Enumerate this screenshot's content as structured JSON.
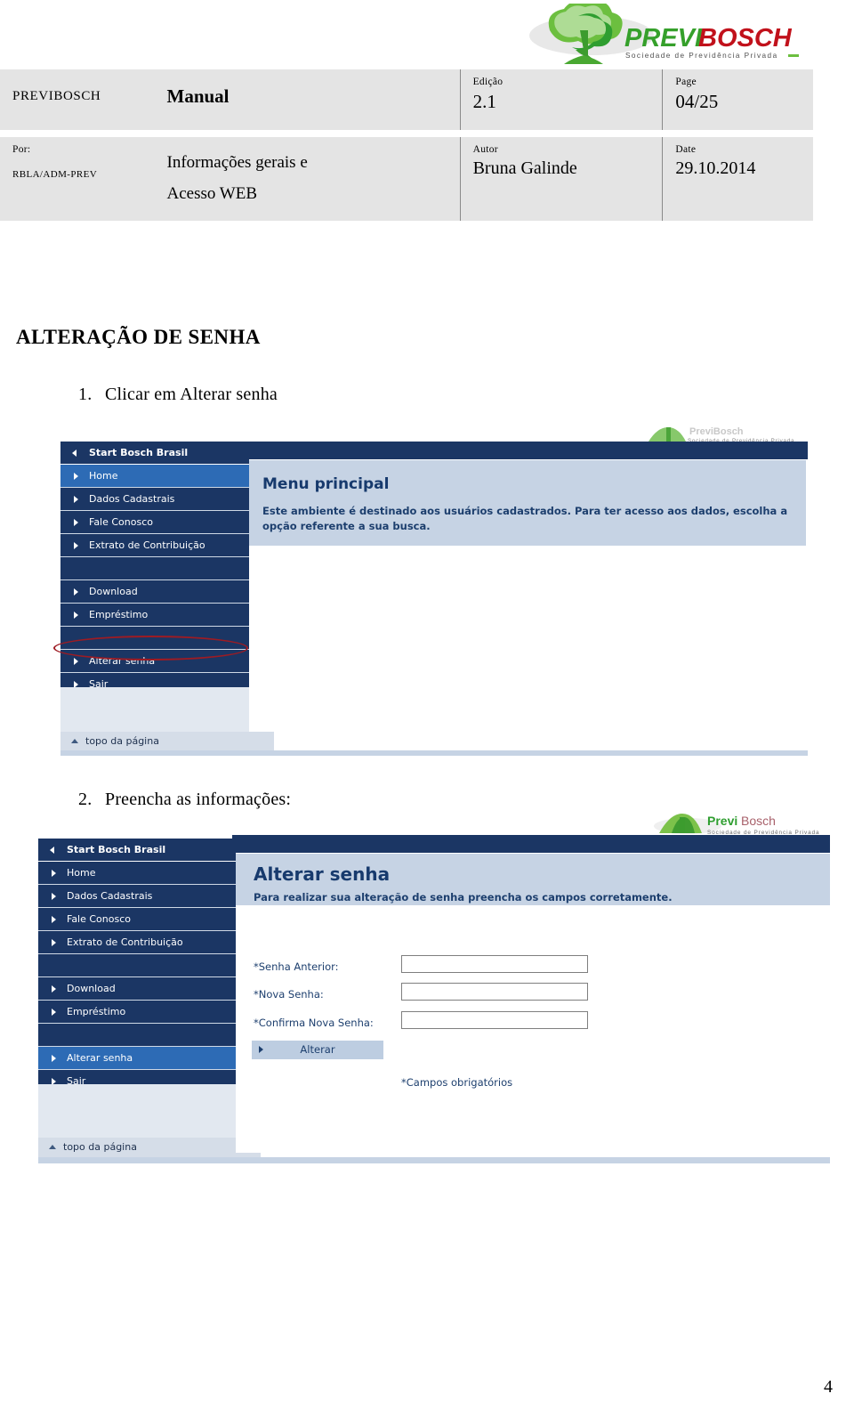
{
  "logo": {
    "name": "previbosch-logo",
    "text_part1": "PREVI",
    "text_part2": "BOSCH",
    "tagline": "Sociedade de Previdência Privada",
    "green": "#4aa829",
    "red": "#c1111b"
  },
  "header_table": {
    "row1": {
      "company": "PREVIBOSCH",
      "doc_type": "Manual",
      "edicao_label": "Edição",
      "edicao_value": "2.1",
      "page_label": "Page",
      "page_value": "04/25"
    },
    "row2": {
      "por_label": "Por:",
      "por_value": "RBLA/ADM-PREV",
      "subject_line1": "Informações gerais e",
      "subject_line2": "Acesso WEB",
      "autor_label": "Autor",
      "autor_value": "Bruna Galinde",
      "date_label": "Date",
      "date_value": "29.10.2014"
    }
  },
  "section": {
    "title": "ALTERAÇÃO DE SENHA"
  },
  "steps": [
    {
      "number": "1.",
      "text": "Clicar em Alterar senha"
    },
    {
      "number": "2.",
      "text": "Preencha as informações:"
    }
  ],
  "screenshot1": {
    "nav": {
      "top_item": "Start Bosch Brasil",
      "items": [
        {
          "label": "Home",
          "active": true
        },
        {
          "label": "Dados Cadastrais",
          "active": false
        },
        {
          "label": "Fale Conosco",
          "active": false
        },
        {
          "label": "Extrato de Contribuição",
          "active": false
        },
        {
          "label": "",
          "active": false
        },
        {
          "label": "Download",
          "active": false
        },
        {
          "label": "Empréstimo",
          "active": false
        },
        {
          "label": "",
          "active": false
        },
        {
          "label": "Alterar senha",
          "active": false
        },
        {
          "label": "Sair",
          "active": false
        }
      ],
      "footer": "topo da página"
    },
    "content": {
      "title": "Menu principal",
      "paragraph": "Este  ambiente é destinado aos usuários cadastrados. Para ter acesso aos dados, escolha a opção referente a sua busca."
    },
    "annotation": "red-ellipse-alterar-senha"
  },
  "screenshot2": {
    "nav": {
      "top_item": "Start Bosch Brasil",
      "items": [
        {
          "label": "Home",
          "active": false
        },
        {
          "label": "Dados Cadastrais",
          "active": false
        },
        {
          "label": "Fale Conosco",
          "active": false
        },
        {
          "label": "Extrato de Contribuição",
          "active": false
        },
        {
          "label": "",
          "active": false
        },
        {
          "label": "Download",
          "active": false
        },
        {
          "label": "Empréstimo",
          "active": false
        },
        {
          "label": "",
          "active": false
        },
        {
          "label": "Alterar senha",
          "active": true
        },
        {
          "label": "Sair",
          "active": false
        }
      ],
      "footer": "topo da página"
    },
    "content": {
      "title": "Alterar senha",
      "paragraph": "Para realizar sua alteração de senha preencha os campos corretamente.",
      "fields": [
        {
          "label": "*Senha Anterior:",
          "value": ""
        },
        {
          "label": "*Nova Senha:",
          "value": ""
        },
        {
          "label": "*Confirma Nova Senha:",
          "value": ""
        }
      ],
      "submit_label": "Alterar",
      "required_note": "*Campos obrigatórios"
    },
    "logo": {
      "text_part1": "Previ",
      "text_part2": "Bosch",
      "tagline": "Sociedade de Previdência Privada"
    }
  },
  "footer": {
    "page_number": "4"
  }
}
